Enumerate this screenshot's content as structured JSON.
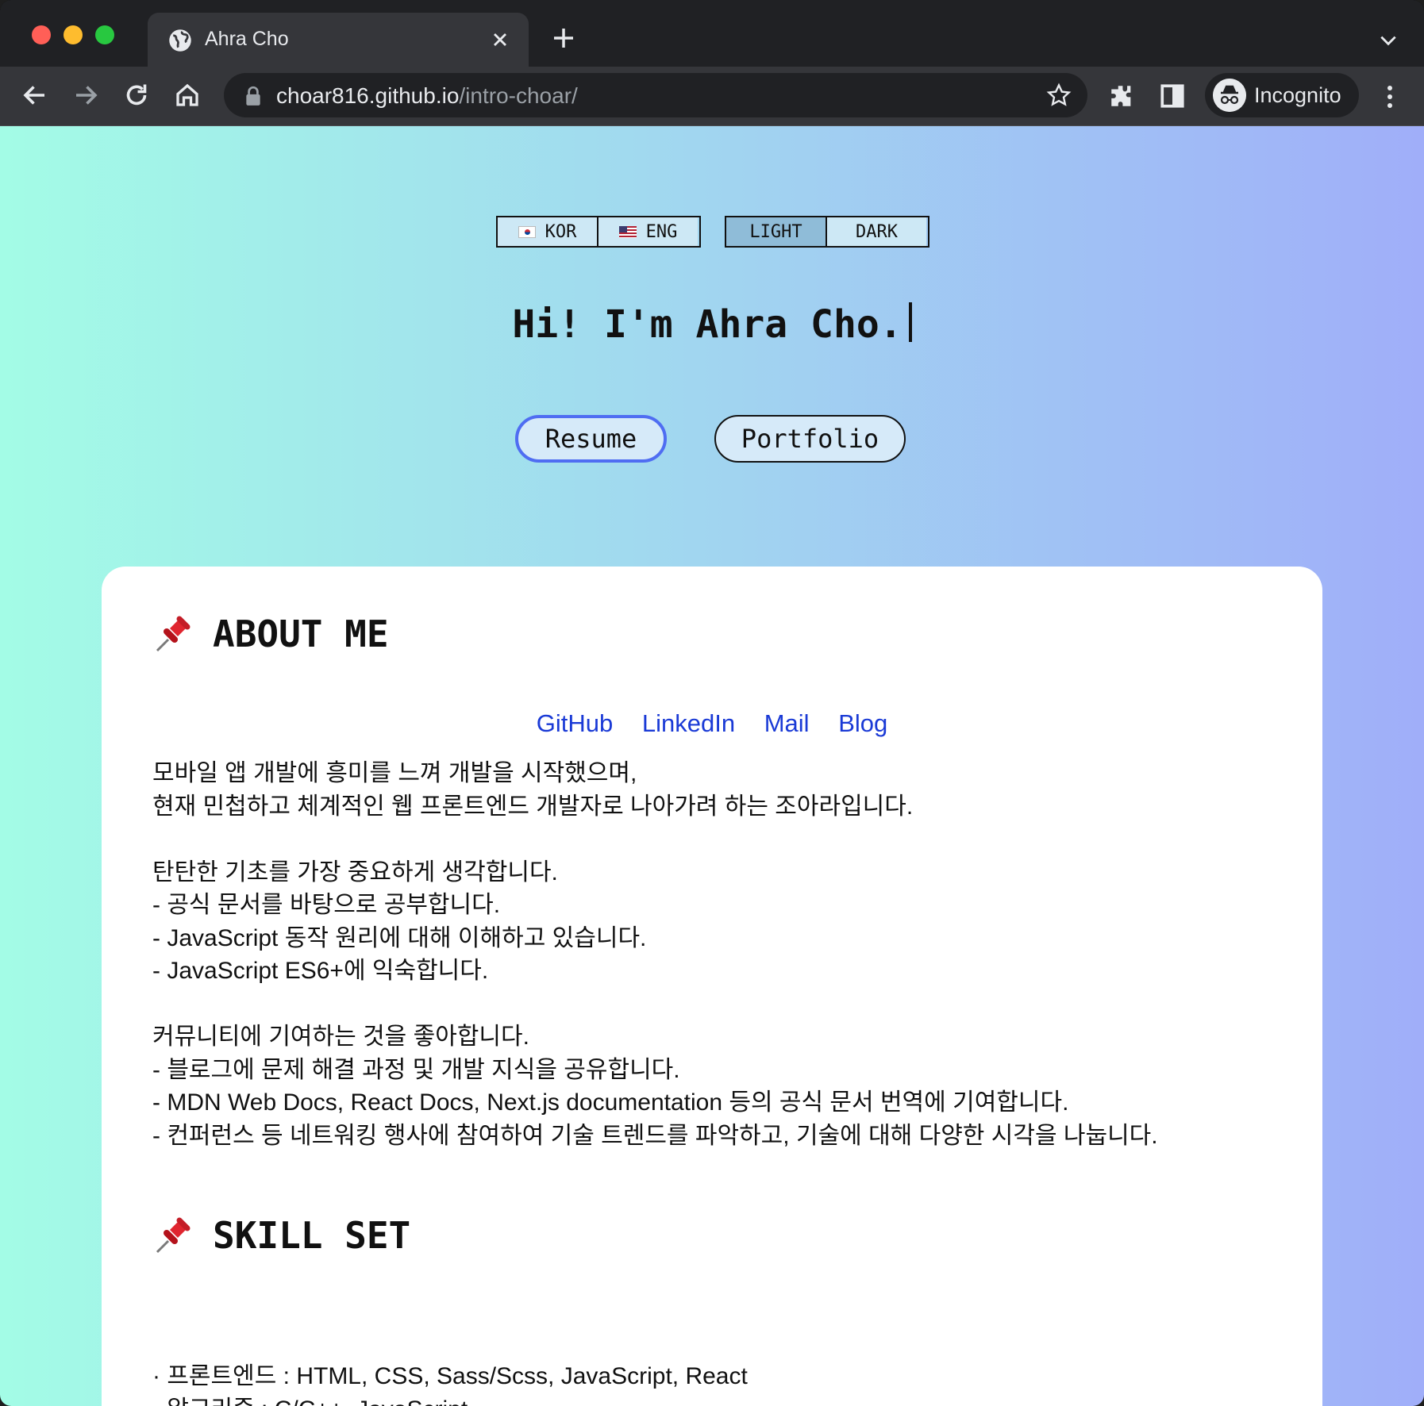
{
  "browser": {
    "tab_title": "Ahra Cho",
    "url_host": "choar816.github.io",
    "url_path": "/intro-choar/",
    "incognito_label": "Incognito"
  },
  "toggles": {
    "language": [
      {
        "label": "KOR",
        "flag": "kr-flag-icon",
        "active": false
      },
      {
        "label": "ENG",
        "flag": "us-flag-icon",
        "active": false
      }
    ],
    "theme": [
      {
        "label": "LIGHT",
        "active": true
      },
      {
        "label": "DARK",
        "active": false
      }
    ]
  },
  "hero": {
    "title": "Hi! I'm Ahra Cho.",
    "resume_label": "Resume",
    "portfolio_label": "Portfolio"
  },
  "about": {
    "heading": "ABOUT ME",
    "links": [
      "GitHub",
      "LinkedIn",
      "Mail",
      "Blog"
    ],
    "paragraphs": [
      [
        "모바일 앱 개발에 흥미를 느껴 개발을 시작했으며,",
        "현재 민첩하고 체계적인 웹 프론트엔드 개발자로 나아가려 하는 조아라입니다."
      ],
      [
        "탄탄한 기초를 가장 중요하게 생각합니다.",
        "- 공식 문서를 바탕으로 공부합니다.",
        "- JavaScript 동작 원리에 대해 이해하고 있습니다.",
        "- JavaScript ES6+에 익숙합니다."
      ],
      [
        "커뮤니티에 기여하는 것을 좋아합니다.",
        "- 블로그에 문제 해결 과정 및 개발 지식을 공유합니다.",
        "- MDN Web Docs, React Docs, Next.js documentation 등의 공식 문서 번역에 기여합니다.",
        "- 컨퍼런스 등 네트워킹 행사에 참여하여 기술 트렌드를 파악하고, 기술에 대해 다양한 시각을 나눕니다."
      ]
    ]
  },
  "skills": {
    "heading": "SKILL SET",
    "items": [
      "· 프론트엔드 : HTML, CSS, Sass/Scss, JavaScript, React",
      "· 알고리즘 : C/C++, JavaScript"
    ]
  },
  "colors": {
    "link": "#1a3ad6",
    "focus_ring": "#4f6df2",
    "gradient_left": "#a3fce6",
    "gradient_right": "#a0aef9"
  }
}
